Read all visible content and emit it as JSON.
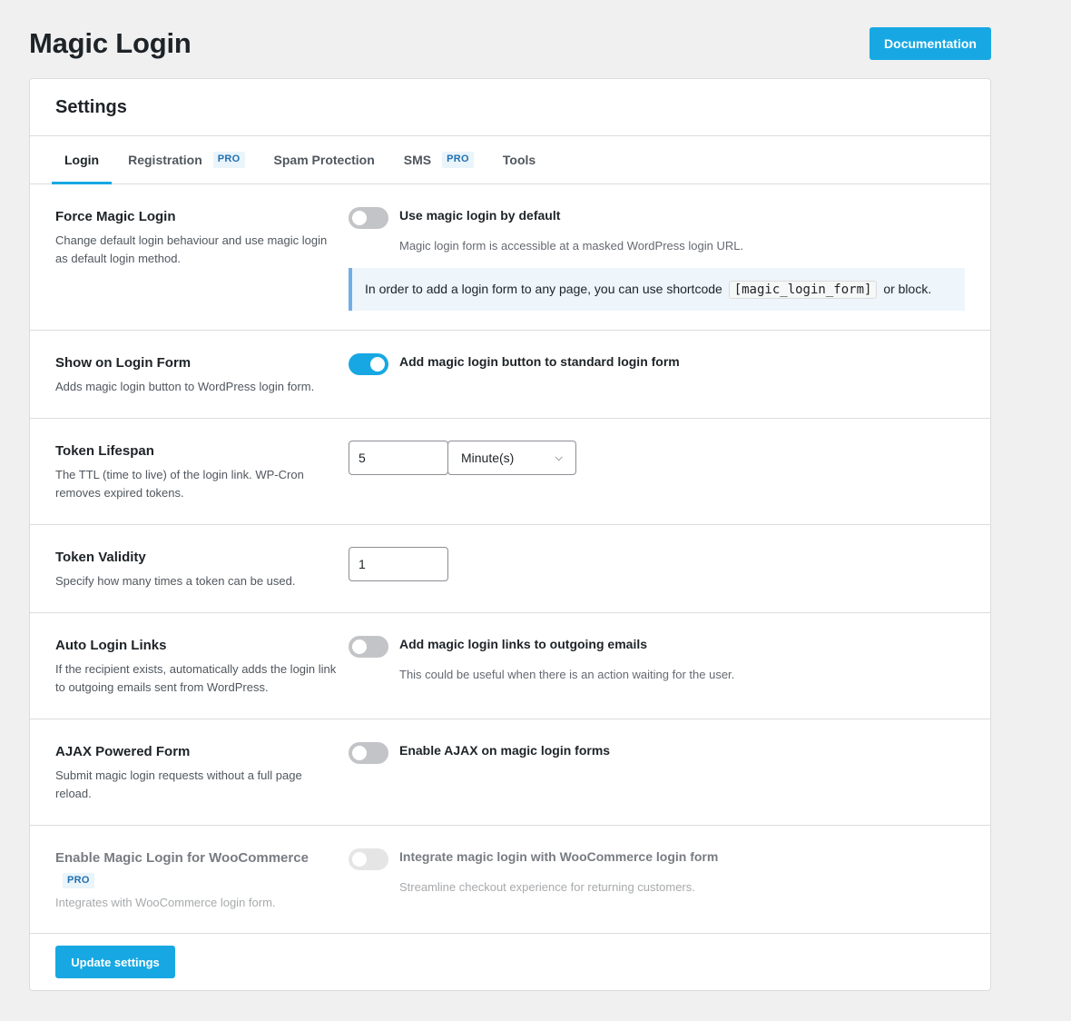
{
  "header": {
    "title": "Magic Login",
    "documentation_label": "Documentation"
  },
  "card": {
    "title": "Settings"
  },
  "tabs": [
    {
      "label": "Login",
      "active": true
    },
    {
      "label": "Registration",
      "badge": "PRO"
    },
    {
      "label": "Spam Protection"
    },
    {
      "label": "SMS",
      "badge": "PRO"
    },
    {
      "label": "Tools"
    }
  ],
  "settings": {
    "force_magic_login": {
      "label": "Force Magic Login",
      "description": "Change default login behaviour and use magic login as default login method.",
      "toggle_label": "Use magic login by default",
      "toggle_on": false,
      "toggle_description": "Magic login form is accessible at a masked WordPress login URL.",
      "notice_before": "In order to add a login form to any page, you can use shortcode",
      "notice_code": "[magic_login_form]",
      "notice_after": "or block."
    },
    "show_on_login_form": {
      "label": "Show on Login Form",
      "description": "Adds magic login button to WordPress login form.",
      "toggle_label": "Add magic login button to standard login form",
      "toggle_on": true
    },
    "token_lifespan": {
      "label": "Token Lifespan",
      "description": "The TTL (time to live) of the login link. WP-Cron removes expired tokens.",
      "value": "5",
      "unit": "Minute(s)"
    },
    "token_validity": {
      "label": "Token Validity",
      "description": "Specify how many times a token can be used.",
      "value": "1"
    },
    "auto_login_links": {
      "label": "Auto Login Links",
      "description": "If the recipient exists, automatically adds the login link to outgoing emails sent from WordPress.",
      "toggle_label": "Add magic login links to outgoing emails",
      "toggle_on": false,
      "toggle_description": "This could be useful when there is an action waiting for the user."
    },
    "ajax_form": {
      "label": "AJAX Powered Form",
      "description": "Submit magic login requests without a full page reload.",
      "toggle_label": "Enable AJAX on magic login forms",
      "toggle_on": false
    },
    "woocommerce": {
      "label": "Enable Magic Login for WooCommerce",
      "badge": "PRO",
      "description": "Integrates with WooCommerce login form.",
      "toggle_label": "Integrate magic login with WooCommerce login form",
      "toggle_on": false,
      "toggle_description": "Streamline checkout experience for returning customers."
    }
  },
  "footer": {
    "update_label": "Update settings"
  },
  "colors": {
    "accent": "#17a8e3",
    "background": "#f0f0f1",
    "pro_badge": "#2271b1"
  }
}
